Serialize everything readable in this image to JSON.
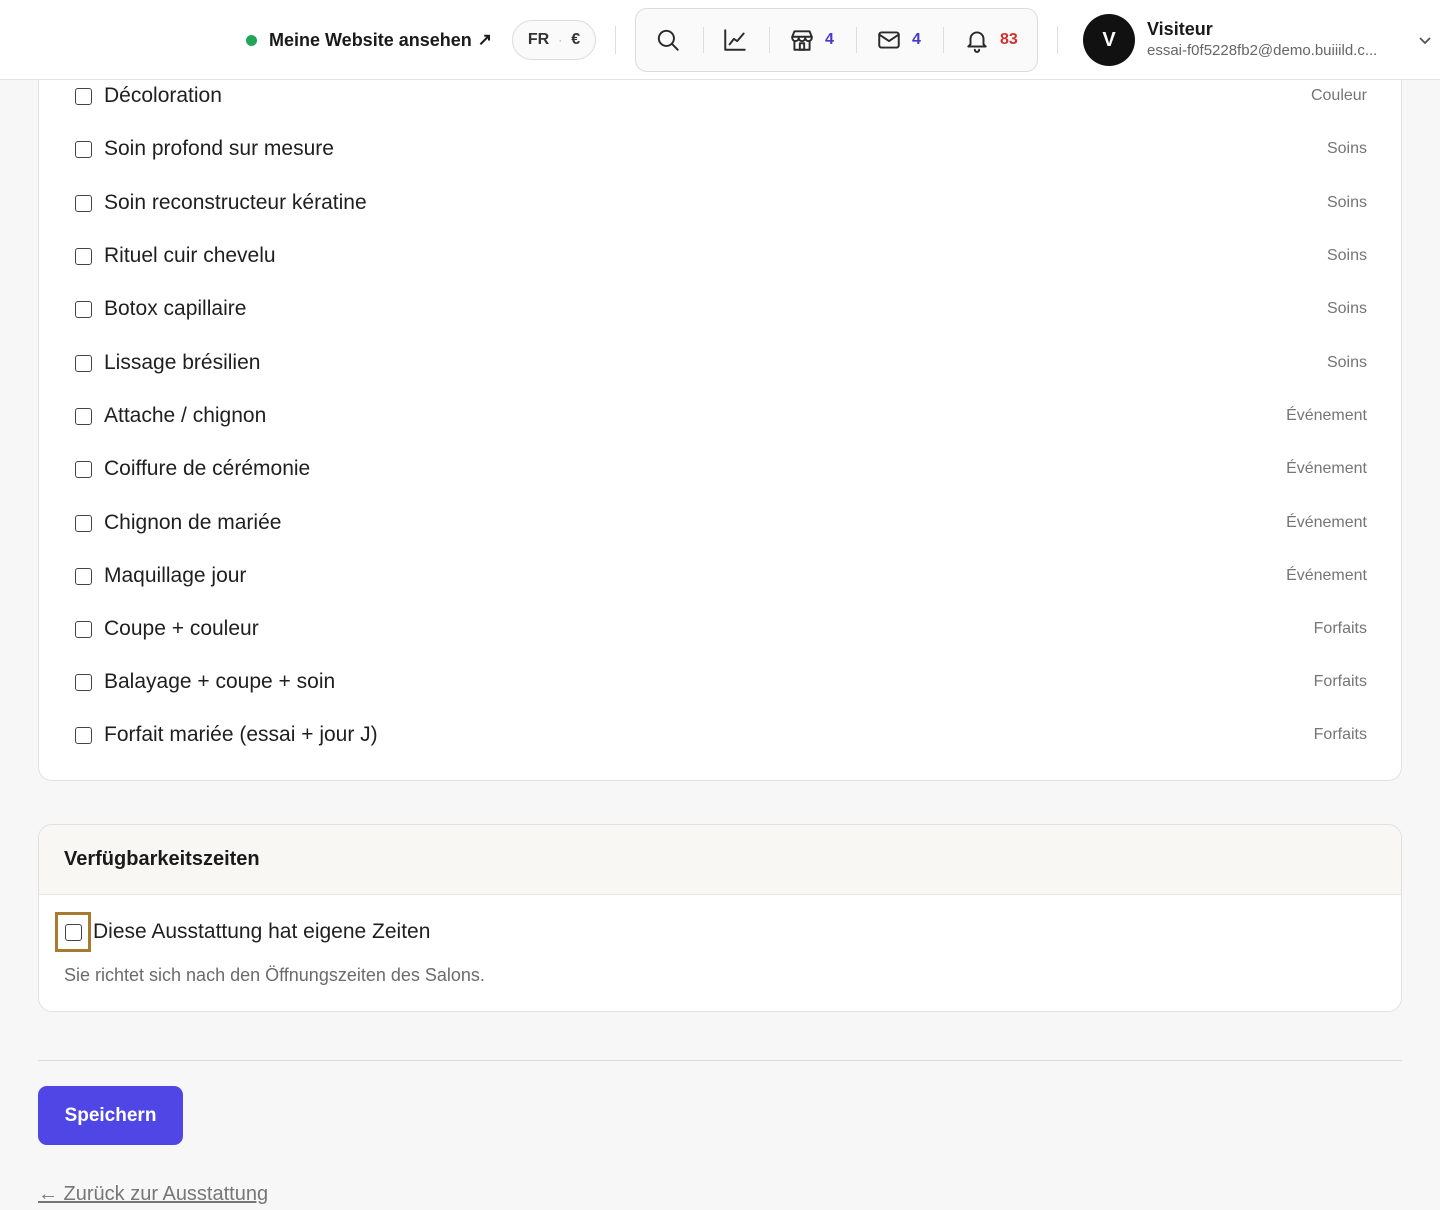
{
  "header": {
    "view_site_label": "Meine Website ansehen",
    "view_site_arrow": "↗",
    "lang": "FR",
    "lang_sep": "·",
    "currency": "€",
    "toolbar": {
      "search_icon": "search-icon",
      "analytics_icon": "chart-line-icon",
      "shop_icon": "store-icon",
      "shop_count": "4",
      "mail_icon": "mail-icon",
      "mail_count": "4",
      "bell_icon": "bell-icon",
      "bell_count": "83"
    },
    "user": {
      "initial": "V",
      "name": "Visiteur",
      "email": "essai-f0f5228fb2@demo.buiiild.c..."
    }
  },
  "services": [
    {
      "label": "Décoloration",
      "category": "Couleur"
    },
    {
      "label": "Soin profond sur mesure",
      "category": "Soins"
    },
    {
      "label": "Soin reconstructeur kératine",
      "category": "Soins"
    },
    {
      "label": "Rituel cuir chevelu",
      "category": "Soins"
    },
    {
      "label": "Botox capillaire",
      "category": "Soins"
    },
    {
      "label": "Lissage brésilien",
      "category": "Soins"
    },
    {
      "label": "Attache / chignon",
      "category": "Événement"
    },
    {
      "label": "Coiffure de cérémonie",
      "category": "Événement"
    },
    {
      "label": "Chignon de mariée",
      "category": "Événement"
    },
    {
      "label": "Maquillage jour",
      "category": "Événement"
    },
    {
      "label": "Coupe + couleur",
      "category": "Forfaits"
    },
    {
      "label": "Balayage + coupe + soin",
      "category": "Forfaits"
    },
    {
      "label": "Forfait mariée (essai + jour J)",
      "category": "Forfaits"
    }
  ],
  "availability": {
    "title": "Verfügbarkeitszeiten",
    "own_times_label": "Diese Ausstattung hat eigene Zeiten",
    "own_times_checked": false,
    "hint": "Sie richtet sich nach den Öffnungszeiten des Salons."
  },
  "actions": {
    "save_label": "Speichern",
    "back_label": "← Zurück zur Ausstattung"
  },
  "colors": {
    "primary": "#5046e5",
    "status_online": "#22a55a",
    "count_blue": "#4338ca",
    "count_red": "#d32f2f",
    "focus": "#a8792f"
  }
}
